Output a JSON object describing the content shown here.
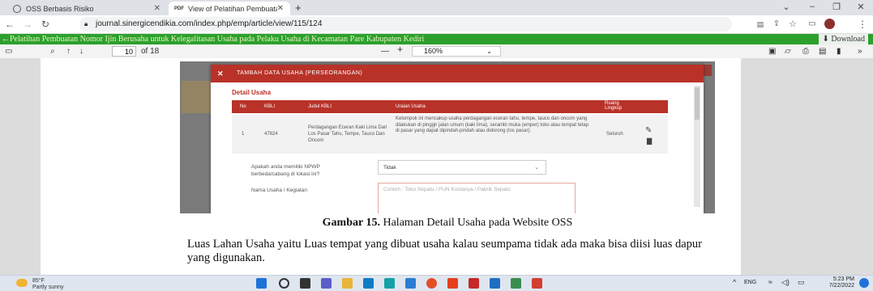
{
  "tabs": [
    {
      "title": "OSS Berbasis Risiko",
      "icon": "oss-icon",
      "active": false
    },
    {
      "title": "View of Pelatihan Pembuatan No",
      "icon": "pdf-icon",
      "active": true
    }
  ],
  "new_tab_label": "+",
  "window": {
    "minimize": "–",
    "maximize": "❐",
    "close": "✕",
    "chevron": "⌄"
  },
  "navigation": {
    "back": "←",
    "forward": "→",
    "reload": "↻",
    "url": "journal.sinergicendikia.com/index.php/emp/article/view/115/124"
  },
  "green_bar": {
    "title": "Pelatihan Pembuatan Nomor Ijin Berusaha untuk Kelegalitasan Usaha pada Pelaku Usaha di Kecamatan Pare Kabupaten Kediri",
    "download": "Download"
  },
  "pdf_toolbar": {
    "page_current": "10",
    "page_total": "of 18",
    "zoom": "160%",
    "minus": "—",
    "plus": "+"
  },
  "modal": {
    "title": "TAMBAH DATA USAHA (PERSEORANGAN)",
    "close": "✕",
    "section": "Detail Usaha",
    "columns": [
      "No",
      "KBLI",
      "Judul KBLI",
      "Uraian Usaha",
      "Ruang Lingkup"
    ],
    "row": {
      "no": "1",
      "kbli": "47824",
      "judul": "Perdagangan Eceran Kaki Lima Dari Los Pasar Tahu, Tempe, Tauco Dan Oncom",
      "uraian": "Kelompok ini mencakup usaha perdagangan eceran tahu, tempe, tauco dan oncom yang dilakukan di pinggir jalan umum (kaki lima), serambi muka (emper) toko atau tempat tetap di pasar yang dapat dipindah-pindah atau didorong (los pasar).",
      "ruang": "Seluruh"
    },
    "question_npwp": "Apakah anda memiliki NPWP berbeda/cabang di lokasi ini?",
    "answer_npwp": "Tidak",
    "label_nama": "Nama Usaha / Kegiatan",
    "placeholder_nama": "Contoh : Toko Sepatu / PUN Kostanya / Pabrik Sepatu"
  },
  "caption": {
    "bold": "Gambar 15.",
    "text": " Halaman Detail Usaha pada Website OSS"
  },
  "body_text": "Luas Lahan Usaha yaitu Luas tempat yang dibuat usaha kalau seumpama tidak ada maka bisa diisi luas dapur yang digunakan.",
  "taskbar": {
    "weather_temp": "85°F",
    "weather_desc": "Partly sunny",
    "lang": "ENG",
    "time": "5:23 PM",
    "date": "7/22/2022"
  },
  "colors": {
    "accent_red": "#b83228",
    "green_bar": "#2ca02c"
  }
}
